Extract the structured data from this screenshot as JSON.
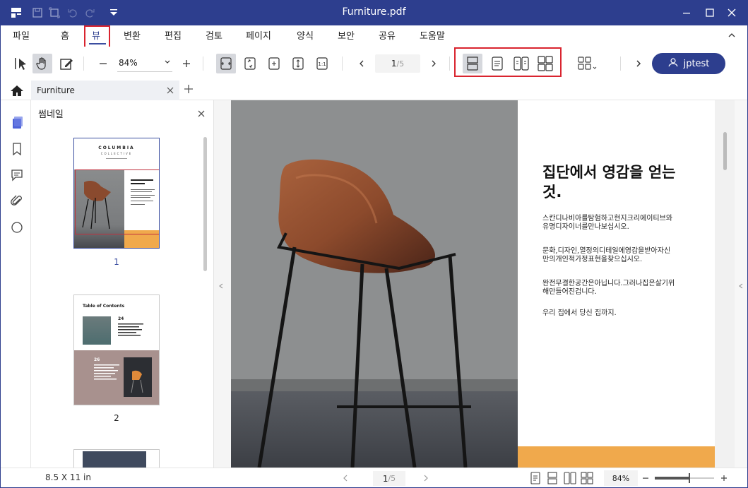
{
  "window": {
    "title": "Furniture.pdf"
  },
  "menu": {
    "items": [
      "파일",
      "홈",
      "뷰",
      "변환",
      "편집",
      "검토",
      "페이지",
      "양식",
      "보안",
      "공유",
      "도움말"
    ],
    "active": "뷰"
  },
  "toolbar": {
    "zoom": "84%",
    "page_current": "1",
    "page_total": "/5",
    "user": "jptest"
  },
  "tab": {
    "label": "Furniture"
  },
  "thumbnails": {
    "title": "썸네일",
    "pages": [
      {
        "num": "1",
        "brand": "COLUMBIA",
        "sub": "COLLECTIVE"
      },
      {
        "num": "2",
        "heading": "Table of Contents",
        "num_a": "24",
        "num_b": "26"
      }
    ]
  },
  "document": {
    "headline": "집단에서 영감을 얻는것.",
    "paragraphs": [
      "스칸디나비아를탐험하고현지크리에이티브와유명디자이너를만나보십시오.",
      "문화,디자인,열정의디테일에영감을받아자신만의개인적가정표현을찾으십시오.",
      "완전무결한공간은아닙니다.그러나집은살기위해만들어진겁니다.",
      "우리 집에서 당신 집까지."
    ],
    "accent": "#f0a94c"
  },
  "status": {
    "page_size": "8.5 X 11 in",
    "page_current": "1",
    "page_total": "/5",
    "zoom": "84%",
    "zoom_level": 0.58
  },
  "colors": {
    "brand": "#2d3e8e",
    "highlight": "#d9242f"
  }
}
